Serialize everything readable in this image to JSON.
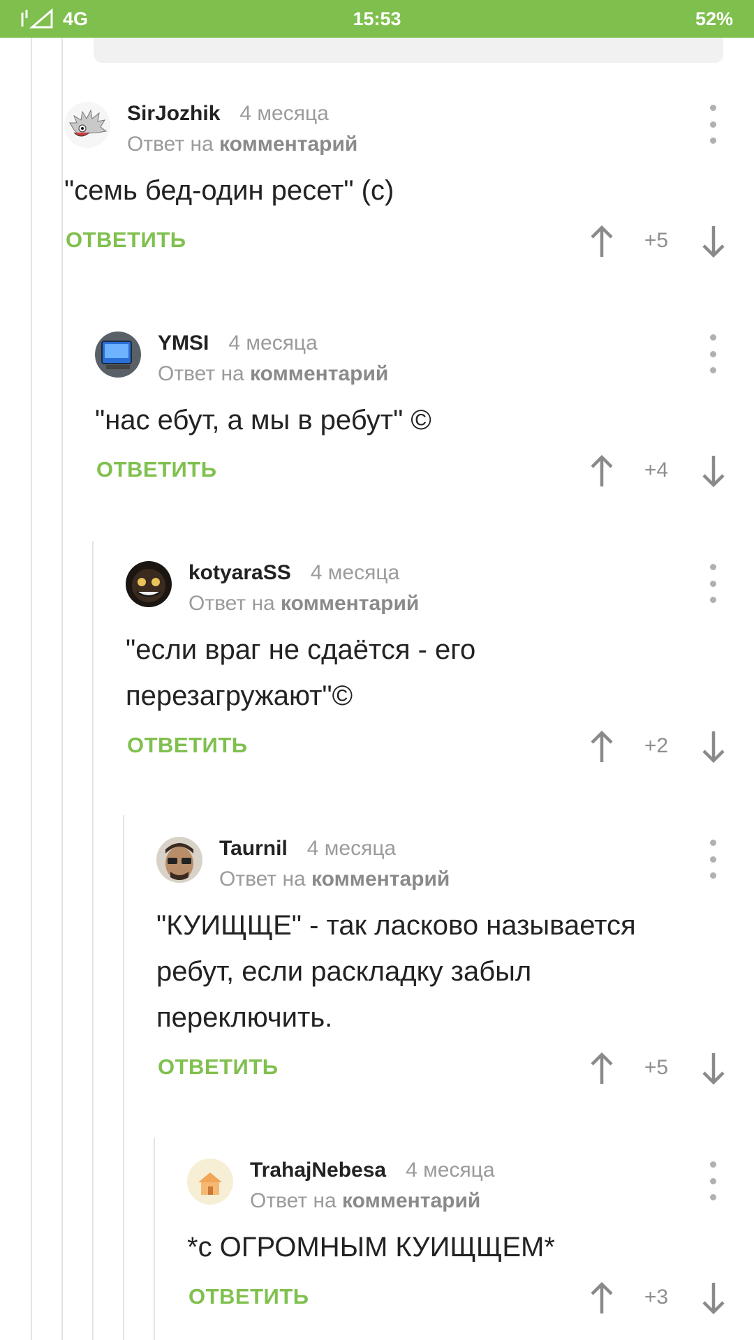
{
  "status_bar": {
    "network": "4G",
    "time": "15:53",
    "battery": "52%"
  },
  "comments": [
    {
      "author": "SirJozhik",
      "time_ago": "4 месяца",
      "reply_prefix": "Ответ на",
      "reply_link": "комментарий",
      "body": "\"семь бед-один ресет\" (с)",
      "reply_label": "ОТВЕТИТЬ",
      "score": "+5"
    },
    {
      "author": "YMSI",
      "time_ago": "4 месяца",
      "reply_prefix": "Ответ на",
      "reply_link": "комментарий",
      "body": "\"нас ебут, а мы в ребут\" ©",
      "reply_label": "ОТВЕТИТЬ",
      "score": "+4"
    },
    {
      "author": "kotyaraSS",
      "time_ago": "4 месяца",
      "reply_prefix": "Ответ на",
      "reply_link": "комментарий",
      "body": "\"если враг не сдаётся - его перезагружают\"©",
      "reply_label": "ОТВЕТИТЬ",
      "score": "+2"
    },
    {
      "author": "Taurnil",
      "time_ago": "4 месяца",
      "reply_prefix": "Ответ на",
      "reply_link": "комментарий",
      "body": "\"КУИЩЩЕ\" - так ласково называется ребут, если раскладку забыл переключить.",
      "reply_label": "ОТВЕТИТЬ",
      "score": "+5"
    },
    {
      "author": "TrahajNebesa",
      "time_ago": "4 месяца",
      "reply_prefix": "Ответ на",
      "reply_link": "комментарий",
      "body": "*с ОГРОМНЫМ КУИЩЩЕМ*",
      "reply_label": "ОТВЕТИТЬ",
      "score": "+3"
    }
  ],
  "colors": {
    "accent_green": "#80c04f",
    "status_bar": "#7fbf4d"
  }
}
